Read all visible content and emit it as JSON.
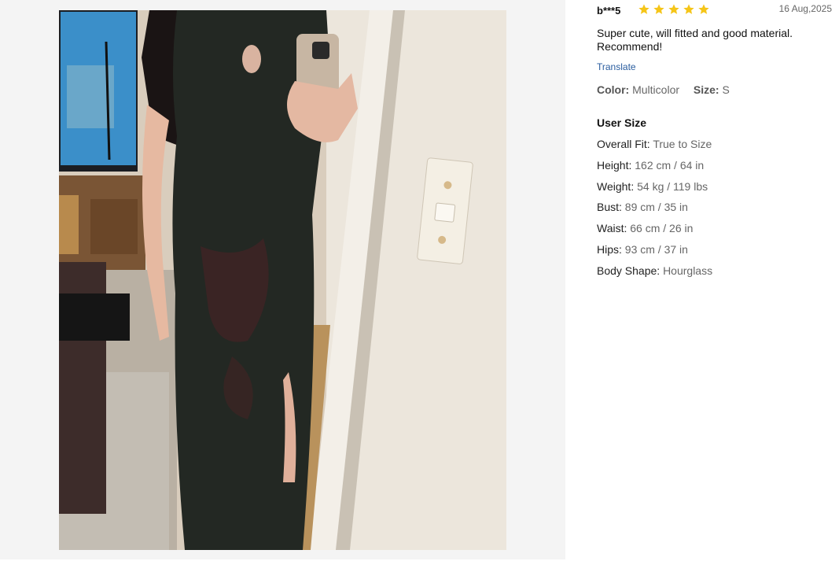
{
  "review": {
    "username": "b***5",
    "rating": 5,
    "date": "16 Aug,2025",
    "text": "Super cute, will fitted and good material. Recommend!",
    "translate_label": "Translate",
    "color_label": "Color:",
    "color_value": "Multicolor",
    "size_label": "Size:",
    "size_value": "S"
  },
  "user_size": {
    "title": "User Size",
    "rows": [
      {
        "label": "Overall Fit:",
        "value": "True to Size"
      },
      {
        "label": "Height:",
        "value": "162 cm / 64 in"
      },
      {
        "label": "Weight:",
        "value": "54 kg / 119 lbs"
      },
      {
        "label": "Bust:",
        "value": "89 cm / 35 in"
      },
      {
        "label": "Waist:",
        "value": "66 cm / 26 in"
      },
      {
        "label": "Hips:",
        "value": "93 cm / 37 in"
      },
      {
        "label": "Body Shape:",
        "value": "Hourglass"
      }
    ]
  },
  "colors": {
    "star": "#f5c518",
    "link": "#2a5d9f"
  },
  "icons": [
    "star-icon"
  ]
}
